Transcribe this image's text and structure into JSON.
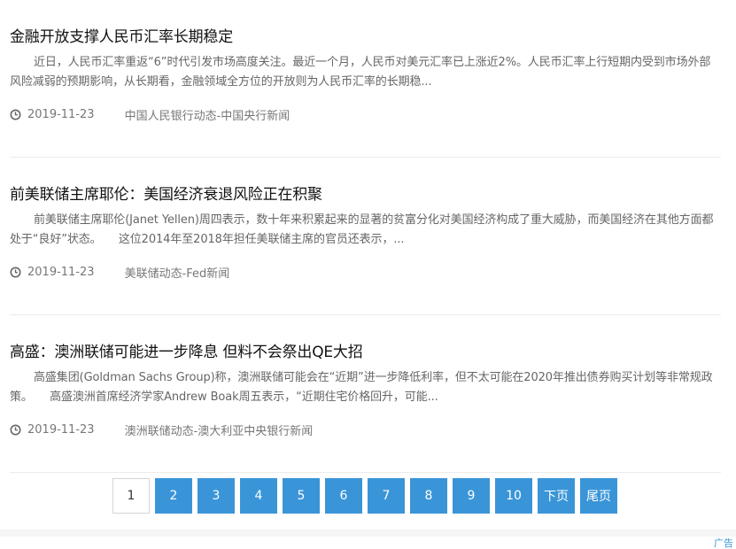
{
  "articles": [
    {
      "title": "金融开放支撑人民币汇率长期稳定",
      "summary": "近日，人民币汇率重返“6”时代引发市场高度关注。最近一个月，人民币对美元汇率已上涨近2%。人民币汇率上行短期内受到市场外部风险减弱的预期影响，从长期看，金融领域全方位的开放则为人民币汇率的长期稳...",
      "date": "2019-11-23",
      "source": "中国人民银行动态-中国央行新闻"
    },
    {
      "title": "前美联储主席耶伦：美国经济衰退风险正在积聚",
      "summary": "前美联储主席耶伦(Janet Yellen)周四表示，数十年来积累起来的显著的贫富分化对美国经济构成了重大威胁，而美国经济在其他方面都处于“良好”状态。　　这位2014年至2018年担任美联储主席的官员还表示，...",
      "date": "2019-11-23",
      "source": "美联储动态-Fed新闻"
    },
    {
      "title": "高盛：澳洲联储可能进一步降息 但料不会祭出QE大招",
      "summary": "高盛集团(Goldman Sachs Group)称，澳洲联储可能会在“近期”进一步降低利率，但不太可能在2020年推出债券购买计划等非常规政策。　　高盛澳洲首席经济学家Andrew Boak周五表示，“近期住宅价格回升，可能...",
      "date": "2019-11-23",
      "source": "澳洲联储动态-澳大利亚中央银行新闻"
    }
  ],
  "pagination": {
    "current": "1",
    "pages": [
      "2",
      "3",
      "4",
      "5",
      "6",
      "7",
      "8",
      "9",
      "10"
    ],
    "next_label": "下页",
    "last_label": "尾页"
  },
  "ad_label": "广告",
  "colors": {
    "accent": "#3a95d8",
    "title": "#111111",
    "summary": "#666666",
    "meta": "#777777"
  },
  "icons": {
    "meta": "clock-icon"
  }
}
